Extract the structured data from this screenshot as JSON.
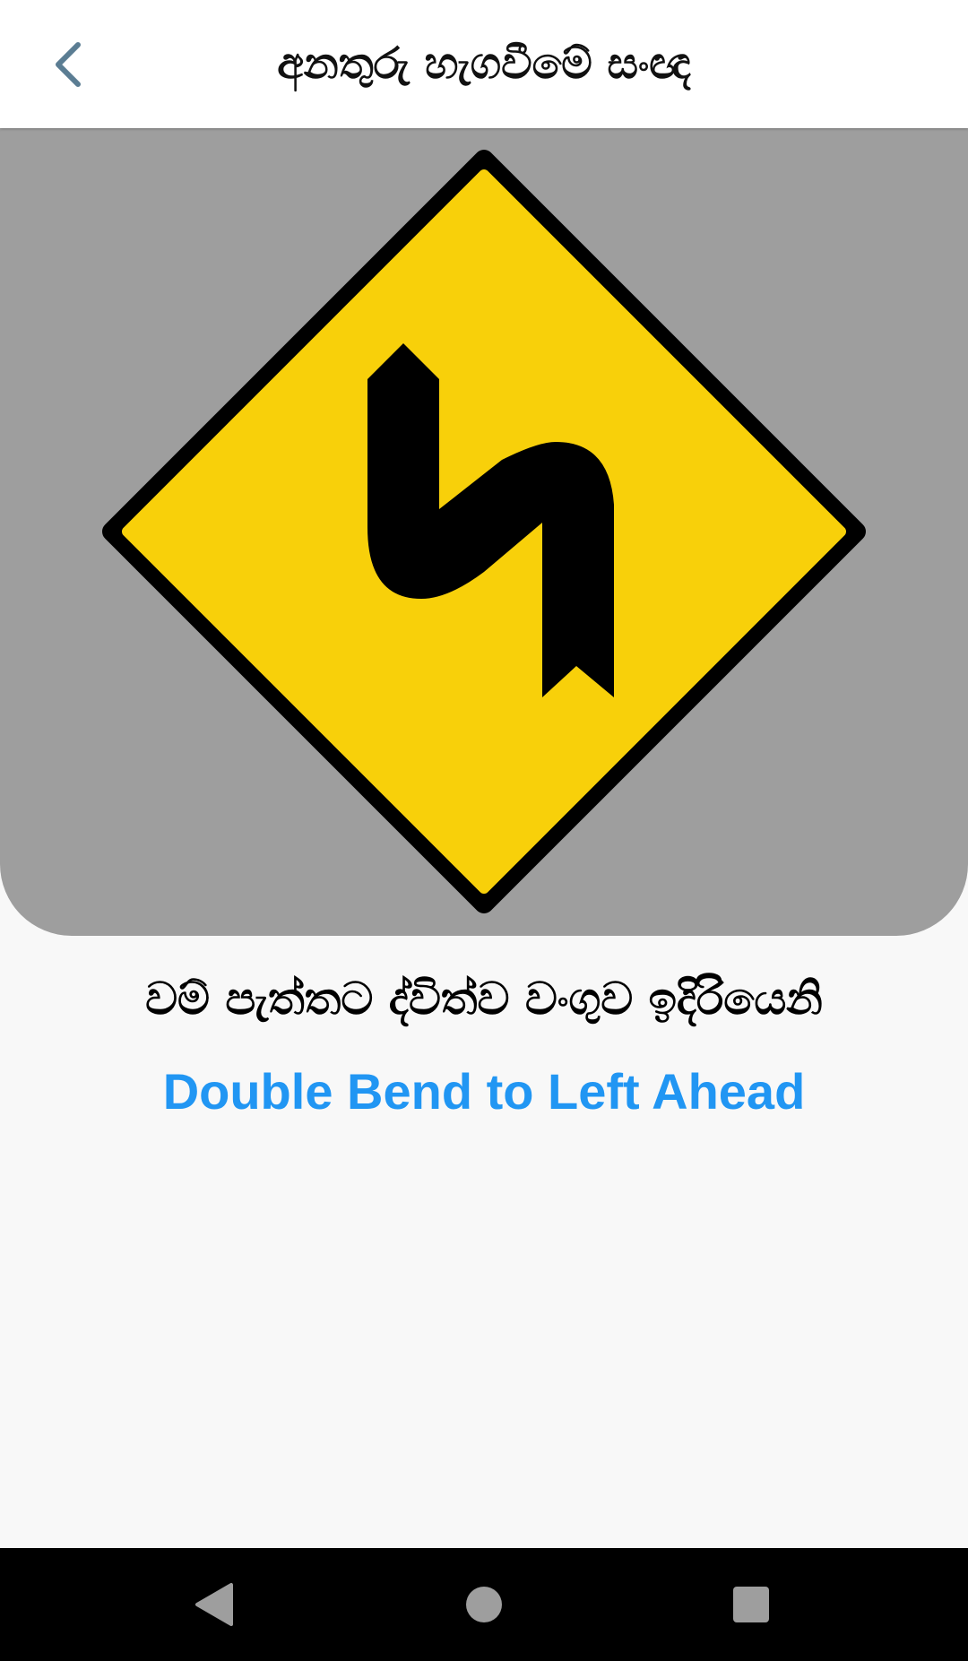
{
  "app_bar": {
    "title": "අනතුරු හැගවීමේ සංඥ",
    "back_icon": "chevron-left-icon"
  },
  "sign": {
    "name_sinhala": "වම් පැත්තට ද්විත්ව වංගුව ඉදිරියෙනි",
    "name_english": "Double Bend to Left Ahead",
    "colors": {
      "panel_background": "#9e9e9e",
      "sign_fill": "#f8d00a",
      "sign_border": "#000000",
      "symbol": "#000000"
    }
  },
  "colors": {
    "accent": "#2196f3",
    "chevron": "#5b7d93"
  },
  "system_nav": {
    "back_icon": "triangle-back-icon",
    "home_icon": "circle-home-icon",
    "recents_icon": "square-recents-icon"
  }
}
